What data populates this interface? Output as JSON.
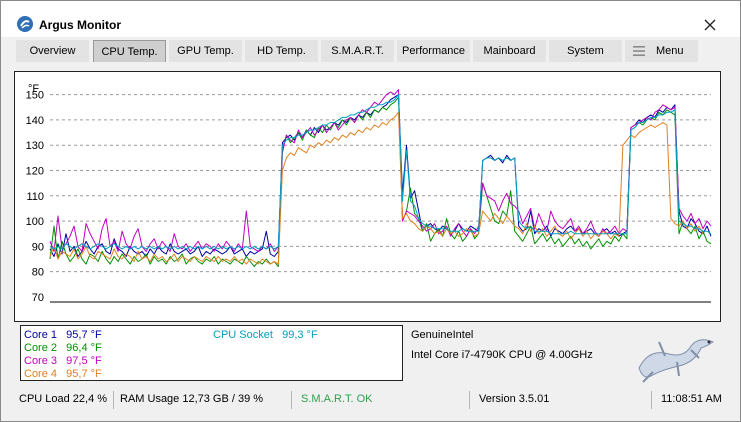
{
  "window": {
    "title": "Argus Monitor"
  },
  "tabs": [
    {
      "label": "Overview",
      "active": false
    },
    {
      "label": "CPU Temp.",
      "active": true
    },
    {
      "label": "GPU Temp.",
      "active": false
    },
    {
      "label": "HD Temp.",
      "active": false
    },
    {
      "label": "S.M.A.R.T.",
      "active": false
    },
    {
      "label": "Performance",
      "active": false
    },
    {
      "label": "Mainboard",
      "active": false
    },
    {
      "label": "System",
      "active": false
    },
    {
      "label": "Menu",
      "active": false,
      "icon": "hamburger-icon"
    }
  ],
  "chart_data": {
    "type": "line",
    "ylabel": "°F",
    "ylim": [
      70,
      155
    ],
    "yticks": [
      70,
      80,
      90,
      100,
      110,
      120,
      130,
      140,
      150
    ],
    "grid": true,
    "x": [
      0,
      2,
      4,
      6,
      8,
      10,
      12,
      14,
      16,
      18,
      20,
      22,
      24,
      26,
      28,
      30,
      32,
      34,
      36,
      38,
      40,
      42,
      44,
      46,
      48,
      50,
      52,
      54,
      56,
      58,
      60,
      62,
      64,
      66,
      68,
      70,
      72,
      74,
      76,
      78,
      80,
      82,
      84,
      86,
      88,
      90,
      92,
      94,
      96,
      98,
      100,
      102,
      104,
      106,
      108,
      110,
      112,
      114,
      116,
      118,
      120,
      122,
      124,
      126,
      128,
      130,
      132,
      134,
      136,
      138,
      140,
      142,
      144,
      146,
      148,
      150,
      152,
      154,
      156,
      158,
      160,
      162,
      164,
      166,
      168,
      170,
      172,
      174,
      176,
      178,
      180,
      182,
      184,
      186,
      188,
      190,
      192,
      194,
      196,
      198,
      200,
      202,
      204,
      206,
      208,
      210,
      212,
      214,
      216,
      218,
      220,
      222,
      224,
      226,
      228,
      230,
      232,
      234,
      236,
      238,
      240,
      242,
      244,
      246,
      248,
      250,
      252,
      254,
      256,
      258,
      260,
      262,
      264,
      266,
      268,
      270,
      272,
      274,
      276,
      278,
      280,
      282,
      284,
      286,
      288,
      290,
      292,
      294,
      296,
      298,
      300,
      302,
      304,
      306,
      308,
      310,
      312,
      314,
      316,
      318,
      320,
      322,
      324,
      326,
      328,
      330
    ],
    "series": [
      {
        "name": "Core 1",
        "color": "#0000a0",
        "values": [
          89,
          86,
          91,
          87,
          95,
          88,
          90,
          86,
          88,
          92,
          89,
          87,
          90,
          91,
          88,
          87,
          93,
          89,
          88,
          86,
          90,
          88,
          87,
          88,
          86,
          89,
          87,
          90,
          88,
          87,
          91,
          88,
          87,
          88,
          89,
          87,
          88,
          90,
          86,
          88,
          87,
          89,
          88,
          87,
          88,
          90,
          87,
          88,
          89,
          86,
          88,
          87,
          88,
          89,
          96,
          87,
          86,
          88,
          131,
          133,
          134,
          132,
          135,
          133,
          136,
          134,
          137,
          135,
          138,
          136,
          137,
          139,
          138,
          140,
          139,
          141,
          140,
          142,
          141,
          143,
          142,
          144,
          143,
          145,
          146,
          148,
          149,
          150,
          111,
          130,
          109,
          112,
          104,
          96,
          98,
          99,
          97,
          96,
          98,
          97,
          95,
          96,
          99,
          97,
          96,
          98,
          97,
          96,
          124,
          125,
          126,
          124,
          125,
          123,
          126,
          124,
          125,
          98,
          96,
          97,
          104,
          95,
          97,
          96,
          98,
          94,
          97,
          96,
          95,
          97,
          98,
          96,
          97,
          95,
          96,
          97,
          95,
          94,
          96,
          97,
          95,
          96,
          94,
          95,
          96,
          137,
          138,
          140,
          139,
          141,
          142,
          141,
          144,
          143,
          145,
          144,
          146,
          104,
          98,
          97,
          101,
          99,
          96,
          95,
          98,
          94
        ]
      },
      {
        "name": "Core 2",
        "color": "#009000",
        "values": [
          85,
          98,
          85,
          92,
          87,
          84,
          86,
          89,
          85,
          83,
          87,
          86,
          84,
          88,
          85,
          83,
          86,
          84,
          87,
          85,
          83,
          86,
          84,
          85,
          87,
          83,
          86,
          84,
          85,
          83,
          86,
          84,
          85,
          87,
          83,
          85,
          86,
          84,
          83,
          85,
          84,
          86,
          83,
          85,
          84,
          83,
          85,
          84,
          83,
          86,
          84,
          82,
          84,
          83,
          85,
          83,
          84,
          82,
          128,
          134,
          131,
          133,
          135,
          132,
          136,
          134,
          133,
          137,
          135,
          138,
          136,
          139,
          137,
          140,
          138,
          141,
          139,
          142,
          140,
          143,
          141,
          144,
          143,
          145,
          144,
          146,
          147,
          149,
          100,
          104,
          113,
          103,
          101,
          96,
          99,
          92,
          95,
          97,
          94,
          101,
          95,
          93,
          96,
          92,
          94,
          97,
          93,
          95,
          115,
          110,
          105,
          100,
          99,
          104,
          102,
          112,
          96,
          94,
          92,
          95,
          98,
          91,
          93,
          95,
          92,
          94,
          91,
          93,
          90,
          92,
          94,
          91,
          93,
          90,
          92,
          89,
          91,
          93,
          90,
          92,
          91,
          94,
          92,
          95,
          93,
          136,
          137,
          139,
          138,
          140,
          141,
          140,
          143,
          142,
          144,
          143,
          142,
          95,
          100,
          97,
          95,
          98,
          93,
          96,
          92,
          91
        ]
      },
      {
        "name": "Core 3",
        "color": "#c000c0",
        "values": [
          92,
          88,
          102,
          89,
          91,
          94,
          98,
          90,
          88,
          99,
          95,
          92,
          89,
          97,
          101,
          90,
          92,
          88,
          96,
          91,
          89,
          94,
          97,
          90,
          88,
          91,
          93,
          89,
          92,
          90,
          88,
          95,
          90,
          89,
          91,
          88,
          90,
          92,
          89,
          91,
          90,
          88,
          91,
          89,
          92,
          90,
          88,
          91,
          89,
          104,
          90,
          89,
          88,
          90,
          89,
          91,
          88,
          90,
          127,
          134,
          132,
          131,
          136,
          133,
          135,
          137,
          134,
          136,
          138,
          135,
          137,
          139,
          136,
          138,
          140,
          141,
          139,
          142,
          144,
          143,
          145,
          147,
          146,
          148,
          150,
          151,
          150,
          152,
          100,
          104,
          103,
          102,
          100,
          98,
          96,
          97,
          99,
          95,
          96,
          98,
          94,
          97,
          99,
          96,
          94,
          97,
          95,
          98,
          115,
          110,
          109,
          108,
          104,
          108,
          111,
          107,
          106,
          104,
          99,
          102,
          105,
          97,
          103,
          99,
          96,
          104,
          100,
          98,
          97,
          99,
          101,
          96,
          98,
          95,
          97,
          100,
          96,
          94,
          97,
          95,
          96,
          98,
          95,
          97,
          96,
          137,
          138,
          139,
          140,
          141,
          140,
          143,
          144,
          146,
          145,
          144,
          145,
          105,
          102,
          100,
          103,
          99,
          101,
          97,
          100,
          98
        ]
      },
      {
        "name": "Core 4",
        "color": "#e08020",
        "values": [
          86,
          90,
          85,
          88,
          87,
          86,
          89,
          85,
          87,
          90,
          86,
          85,
          88,
          87,
          86,
          85,
          89,
          86,
          85,
          87,
          86,
          84,
          88,
          85,
          86,
          84,
          87,
          85,
          86,
          84,
          85,
          87,
          84,
          86,
          85,
          84,
          86,
          85,
          84,
          86,
          85,
          84,
          86,
          84,
          85,
          84,
          86,
          84,
          85,
          83,
          85,
          84,
          83,
          85,
          84,
          83,
          84,
          83,
          120,
          125,
          127,
          126,
          129,
          128,
          127,
          130,
          129,
          131,
          130,
          132,
          131,
          133,
          132,
          134,
          133,
          135,
          134,
          136,
          135,
          137,
          136,
          138,
          137,
          139,
          138,
          140,
          141,
          143,
          101,
          103,
          100,
          99,
          97,
          96,
          98,
          97,
          95,
          96,
          94,
          97,
          95,
          96,
          94,
          95,
          97,
          96,
          94,
          95,
          104,
          102,
          100,
          103,
          101,
          99,
          102,
          100,
          98,
          97,
          95,
          99,
          96,
          98,
          95,
          97,
          94,
          96,
          98,
          95,
          94,
          96,
          93,
          95,
          97,
          94,
          96,
          93,
          95,
          94,
          96,
          95,
          93,
          95,
          94,
          130,
          132,
          134,
          133,
          135,
          136,
          137,
          138,
          137,
          138,
          139,
          138,
          101,
          99,
          98,
          100,
          97,
          99,
          96,
          98,
          95
        ]
      },
      {
        "name": "CPU Socket",
        "color": "#00a0c0",
        "values": [
          90,
          89,
          90,
          89,
          91,
          90,
          89,
          90,
          91,
          90,
          89,
          90,
          91,
          90,
          89,
          90,
          91,
          90,
          89,
          90,
          89,
          90,
          89,
          90,
          89,
          90,
          89,
          90,
          89,
          90,
          89,
          90,
          89,
          90,
          89,
          90,
          89,
          90,
          89,
          90,
          89,
          90,
          89,
          90,
          89,
          90,
          89,
          90,
          89,
          90,
          89,
          90,
          89,
          90,
          89,
          90,
          89,
          90,
          130,
          132,
          133,
          133,
          134,
          134,
          135,
          136,
          136,
          137,
          138,
          138,
          139,
          139,
          140,
          141,
          141,
          142,
          142,
          143,
          143,
          144,
          145,
          145,
          146,
          146,
          147,
          147,
          148,
          150,
          108,
          128,
          108,
          106,
          101,
          99,
          98,
          98,
          97,
          97,
          97,
          97,
          96,
          96,
          96,
          97,
          96,
          96,
          96,
          96,
          124,
          125,
          125,
          124,
          125,
          124,
          125,
          124,
          125,
          100,
          98,
          97,
          98,
          96,
          96,
          96,
          96,
          95,
          95,
          95,
          95,
          95,
          96,
          95,
          95,
          95,
          95,
          95,
          95,
          95,
          95,
          95,
          95,
          95,
          95,
          95,
          95,
          136,
          137,
          139,
          139,
          140,
          141,
          141,
          142,
          142,
          143,
          143,
          144,
          100,
          99,
          98,
          98,
          97,
          97,
          96,
          96,
          95
        ]
      }
    ]
  },
  "legend": {
    "core1": "Core 1   95,7 °F",
    "core2": "Core 2   96,4 °F",
    "core3": "Core 3   97,5 °F",
    "core4": "Core 4   95,7 °F",
    "socket": "CPU Socket   99,3 °F",
    "colors": {
      "core1": "#0000a0",
      "core2": "#009000",
      "core3": "#c000c0",
      "core4": "#e08020",
      "socket": "#00a0c0"
    }
  },
  "cpu": {
    "vendor": "GenuineIntel",
    "model": "Intel Core i7-4790K CPU @ 4.00GHz"
  },
  "status": {
    "cpu_load": "CPU Load 22,4 %",
    "ram_usage": "RAM Usage 12,73 GB / 39 %",
    "smart": "S.M.A.R.T. OK",
    "smart_color": "#2ea04a",
    "version": "Version 3.5.01",
    "time": "11:08:51 AM"
  }
}
